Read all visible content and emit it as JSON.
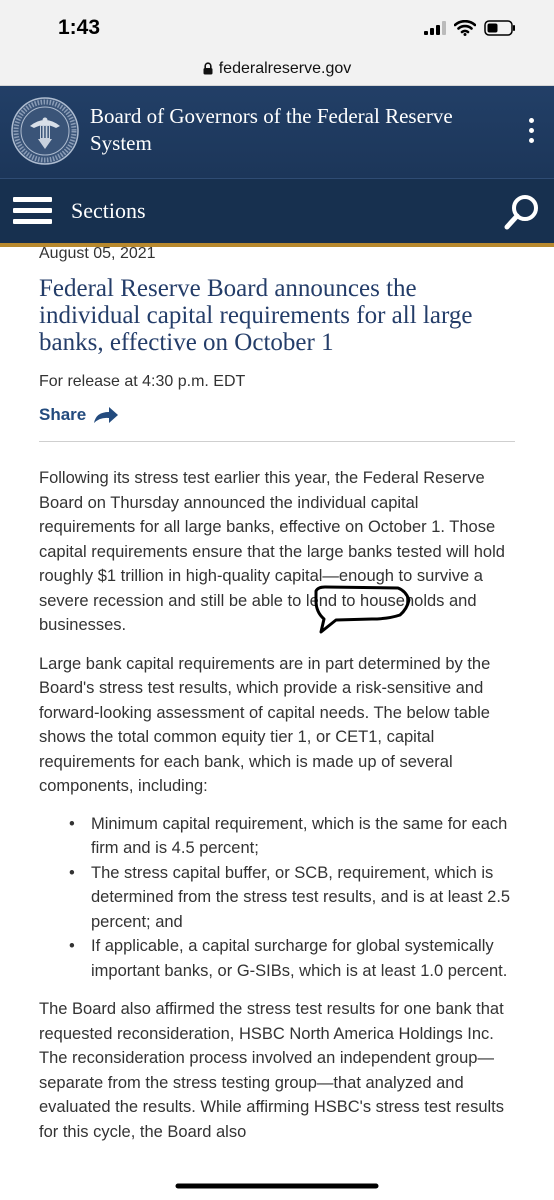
{
  "status_bar": {
    "time": "1:43"
  },
  "browser": {
    "url": "federalreserve.gov"
  },
  "site_header": {
    "title": "Board of Governors of the Federal Reserve System"
  },
  "nav": {
    "sections_label": "Sections"
  },
  "article": {
    "date": "August 05, 2021",
    "headline": "Federal Reserve Board announces the individual capital requirements for all large banks, effective on October 1",
    "release_time": "For release at 4:30 p.m. EDT",
    "share_label": "Share",
    "paragraph1": "Following its stress test earlier this year, the Federal Reserve Board on Thursday announced the individual capital requirements for all large banks, effective on October 1. Those capital requirements ensure that the large banks tested will hold roughly $1 trillion in high-quality capital—enough to survive a severe recession and still be able to lend to households and businesses.",
    "paragraph2": "Large bank capital requirements are in part determined by the Board's stress test results, which provide a risk-sensitive and forward-looking assessment of capital needs. The below table shows the total common equity tier 1, or CET1, capital requirements for each bank, which is made up of several components, including:",
    "bullets": [
      "Minimum capital requirement, which is the same for each firm and is 4.5 percent;",
      "The stress capital buffer, or SCB, requirement, which is determined from the stress test results, and is at least 2.5 percent; and",
      "If applicable, a capital surcharge for global systemically important banks, or G-SIBs, which is at least 1.0 percent."
    ],
    "paragraph3": "The Board also affirmed the stress test results for one bank that requested reconsideration, HSBC North America Holdings Inc. The reconsideration process involved an independent group—separate from the stress testing group—that analyzed and evaluated the results. While affirming HSBC's stress test results for this cycle, the Board also"
  },
  "colors": {
    "header_navy": "#1f3a5f",
    "gold_rule": "#b8892e",
    "headline_blue": "#243d69",
    "link_blue": "#234b7e"
  }
}
